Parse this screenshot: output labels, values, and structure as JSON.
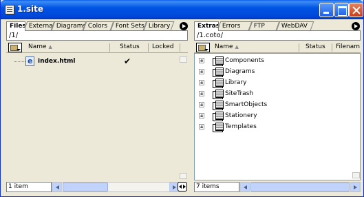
{
  "window": {
    "title": "1.site"
  },
  "left_panel": {
    "tabs": [
      "Files",
      "External",
      "Diagrams",
      "Colors",
      "Font Sets",
      "Library"
    ],
    "path": "/1/",
    "columns": {
      "name": "Name",
      "status": "Status",
      "locked": "Locked"
    },
    "items": [
      {
        "name": "index.html",
        "locked": "✔"
      }
    ],
    "item_count": "1 item"
  },
  "right_panel": {
    "tabs": [
      "Extras",
      "Errors",
      "FTP",
      "WebDAV"
    ],
    "path": "/1.coto/",
    "columns": {
      "name": "Name",
      "status": "Status",
      "filename": "Filenam"
    },
    "items": [
      "Components",
      "Diagrams",
      "Library",
      "SiteTrash",
      "SmartObjects",
      "Stationery",
      "Templates"
    ],
    "item_count": "7 items"
  },
  "colors": {
    "titlebar": "#0055e5",
    "accent": "#0831d9"
  }
}
